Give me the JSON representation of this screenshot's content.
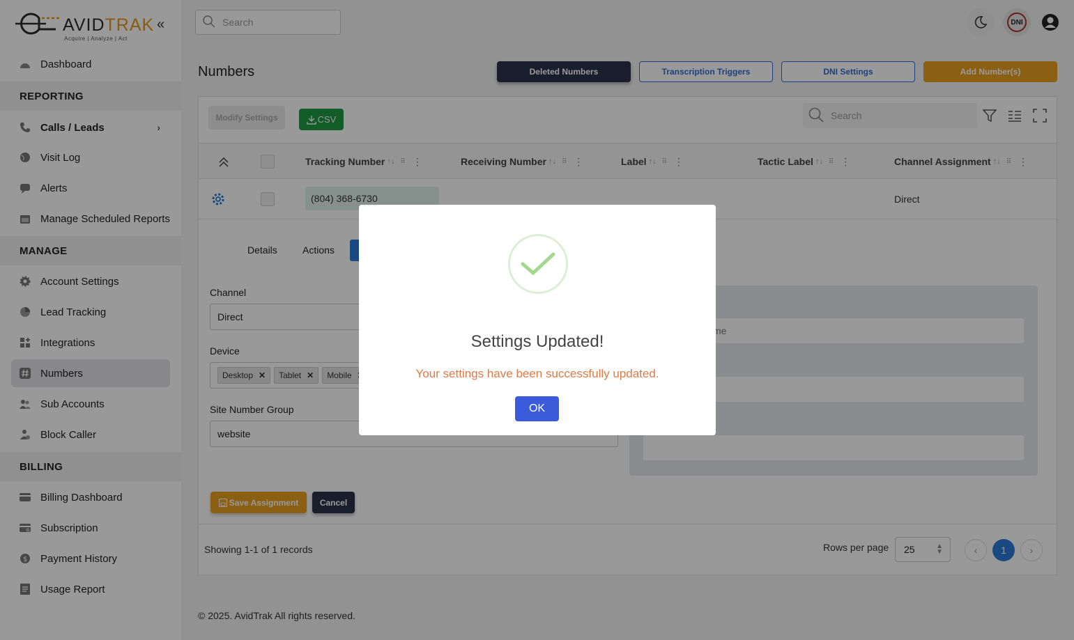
{
  "app": {
    "brand_prefix": "AVID",
    "brand_suffix": "TRAK",
    "tagline": "Acquire | Analyze | Act"
  },
  "sidebar": {
    "items": [
      {
        "label": "Dashboard",
        "icon": "dashboard-icon"
      },
      {
        "label": "Calls / Leads",
        "icon": "phone-icon"
      },
      {
        "label": "Visit Log",
        "icon": "globe-icon"
      },
      {
        "label": "Alerts",
        "icon": "chat-icon"
      },
      {
        "label": "Manage Scheduled Reports",
        "icon": "calendar-icon"
      },
      {
        "label": "Account Settings",
        "icon": "gear-icon"
      },
      {
        "label": "Lead Tracking",
        "icon": "pie-chart-icon"
      },
      {
        "label": "Integrations",
        "icon": "grid-icon"
      },
      {
        "label": "Numbers",
        "icon": "hash-icon"
      },
      {
        "label": "Sub Accounts",
        "icon": "users-icon"
      },
      {
        "label": "Block Caller",
        "icon": "user-block-icon"
      },
      {
        "label": "Billing Dashboard",
        "icon": "card-icon"
      },
      {
        "label": "Subscription",
        "icon": "card-clock-icon"
      },
      {
        "label": "Payment History",
        "icon": "dollar-icon"
      },
      {
        "label": "Usage Report",
        "icon": "report-icon"
      }
    ],
    "sections": [
      "REPORTING",
      "MANAGE",
      "BILLING"
    ]
  },
  "header": {
    "search_placeholder": "Search",
    "dni_badge": "DNI"
  },
  "page": {
    "title": "Numbers",
    "buttons": {
      "deleted": "Deleted Numbers",
      "transcription": "Transcription Triggers",
      "dni_settings": "DNI Settings",
      "add": "Add Number(s)"
    }
  },
  "table": {
    "modify_settings": "Modify Settings",
    "csv": "CSV",
    "search_placeholder": "Search",
    "columns": [
      "Tracking Number",
      "Receiving Number",
      "Label",
      "Tactic Label",
      "Channel Assignment"
    ],
    "row": {
      "tracking_number": "(804) 368-6730",
      "channel_assignment": "Direct"
    }
  },
  "detail": {
    "tabs": [
      "Details",
      "Actions"
    ],
    "channel_label": "Channel",
    "channel_value": "Direct",
    "device_label": "Device",
    "device_chips": [
      "Desktop",
      "Tablet",
      "Mobile"
    ],
    "site_group_label": "Site Number Group",
    "site_group_value": "website",
    "partial_input_text": "me",
    "save": "Save Assignment",
    "cancel": "Cancel"
  },
  "pagination": {
    "showing": "Showing 1-1 of 1 records",
    "rows_per_page_label": "Rows per page",
    "rows_per_page": "25",
    "current_page": "1"
  },
  "footer": {
    "copyright": "© 2025. AvidTrak All rights reserved."
  },
  "modal": {
    "title": "Settings Updated!",
    "message": "Your settings have been successfully updated.",
    "ok": "OK"
  },
  "colors": {
    "accent_orange": "#e8a021",
    "dark_button": "#2c3148",
    "link_blue": "#2f6fcf",
    "success_green": "#1e9a44",
    "ok_blue": "#3b5bdb",
    "message_orange": "#e07a45"
  }
}
